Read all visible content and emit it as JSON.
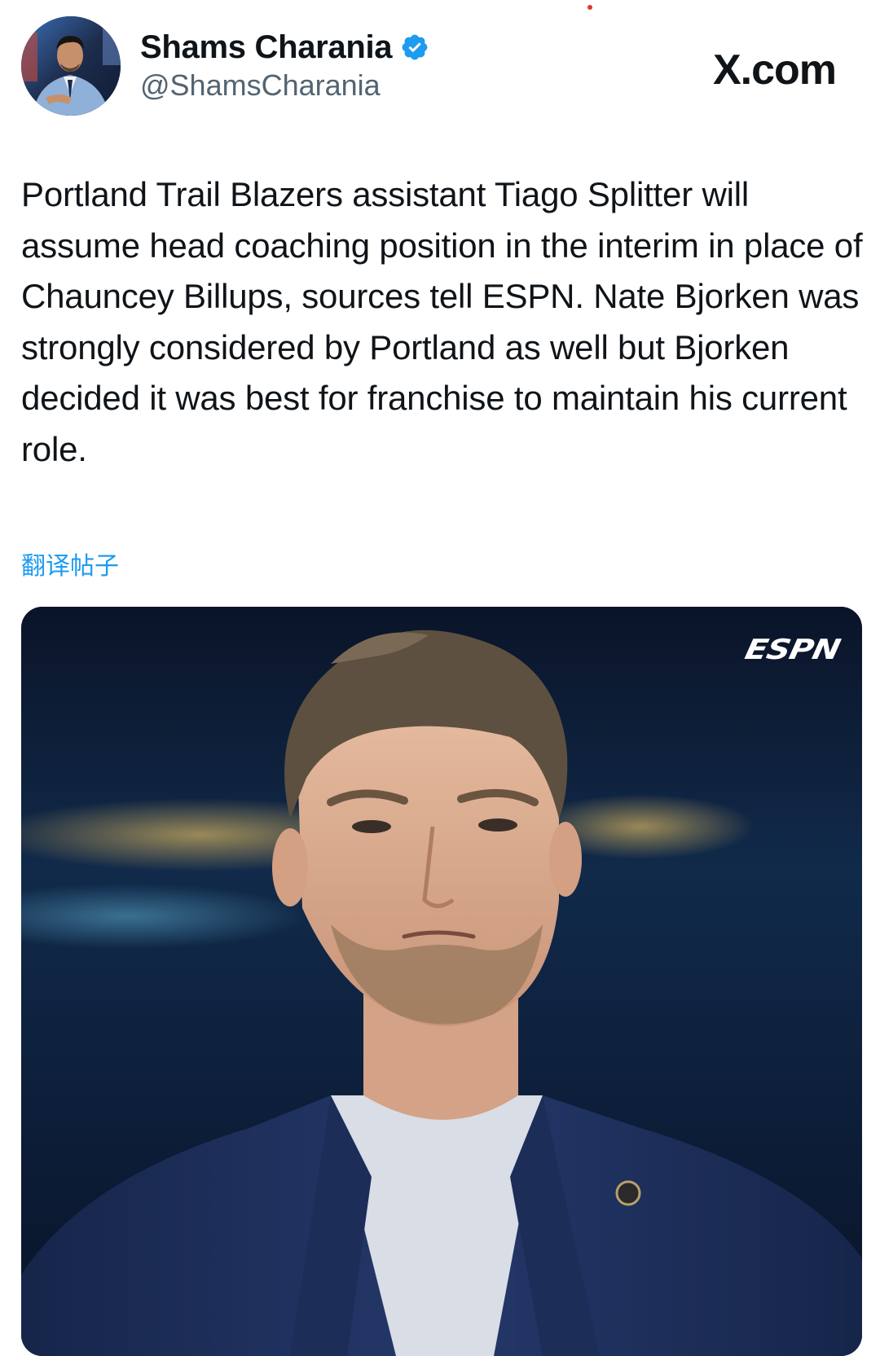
{
  "post": {
    "author": {
      "display_name": "Shams Charania",
      "handle": "@ShamsCharania",
      "verified": true,
      "avatar_icon": "profile-photo"
    },
    "brand": "X.com",
    "text": "Portland Trail Blazers assistant Tiago Splitter will assume head coaching position in the interim in place of Chauncey Billups, sources tell ESPN. Nate Bjorken was strongly considered by Portland as well but Bjorken decided it was best for franchise to maintain his current role.",
    "translate_label": "翻译帖子",
    "media": {
      "watermark": "ESPN",
      "description_icon": "photo"
    }
  },
  "colors": {
    "verified_badge": "#1d9bf0",
    "link": "#1d9bf0",
    "handle": "#536471",
    "text": "#0f1419",
    "media_bg": "#0b1830"
  }
}
